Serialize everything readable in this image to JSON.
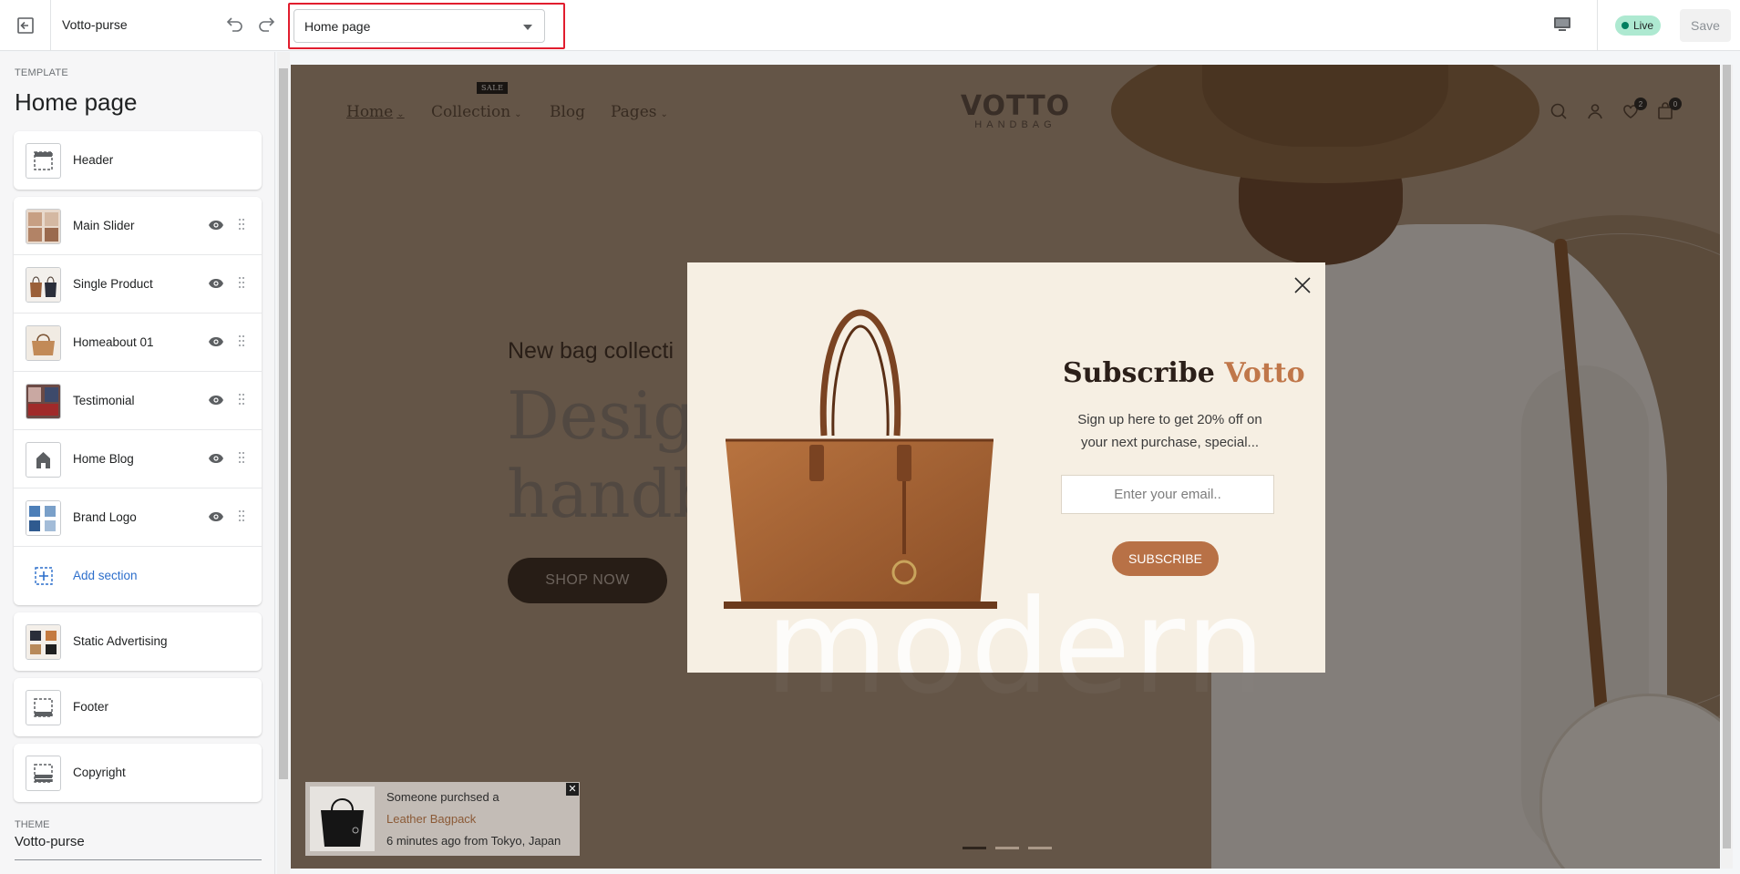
{
  "topbar": {
    "store_name": "Votto-purse",
    "page_select": "Home page",
    "live_label": "Live",
    "save_label": "Save"
  },
  "sidebar": {
    "template_label": "TEMPLATE",
    "template_title": "Home page",
    "header_item": "Header",
    "sections": [
      {
        "label": "Main Slider"
      },
      {
        "label": "Single Product"
      },
      {
        "label": "Homeabout 01"
      },
      {
        "label": "Testimonial"
      },
      {
        "label": "Home Blog"
      },
      {
        "label": "Brand Logo"
      }
    ],
    "add_section": "Add section",
    "static_advertising": "Static Advertising",
    "footer_item": "Footer",
    "copyright_item": "Copyright",
    "theme_label": "THEME",
    "theme_name": "Votto-purse"
  },
  "preview": {
    "nav": {
      "home": "Home",
      "collection": "Collection",
      "blog": "Blog",
      "pages": "Pages",
      "sale_badge": "SALE"
    },
    "logo": {
      "main": "VOTTO",
      "sub": "HANDBAG"
    },
    "wishlist_count": "2",
    "cart_count": "0",
    "hero": {
      "subtitle": "New bag collecti",
      "title_line1": "Desigr",
      "title_line2": "handb",
      "button": "SHOP NOW",
      "watermark": "modern"
    },
    "popup": {
      "title_main": "Subscribe",
      "title_accent": "Votto",
      "text": "Sign up here to get 20% off on your next purchase, special...",
      "email_placeholder": "Enter your email..",
      "button": "SUBSCRIBE",
      "watermark": "modern"
    },
    "toast": {
      "line1": "Someone purchsed a",
      "product": "Leather Bagpack",
      "line3": "6 minutes ago from Tokyo, Japan"
    }
  },
  "colors": {
    "accent": "#c0774a",
    "highlight": "#e11d2e",
    "live_badge": "#aee9d1"
  }
}
